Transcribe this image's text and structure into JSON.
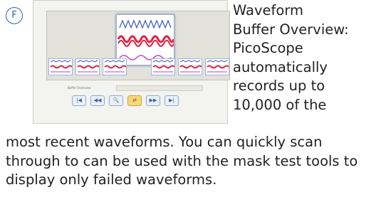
{
  "badge": {
    "letter": "F"
  },
  "screenshot": {
    "field_label": "Buffer Overview",
    "buttons": [
      {
        "glyph": "|◀",
        "icon": "first-icon"
      },
      {
        "glyph": "◀◀",
        "icon": "previous-icon"
      },
      {
        "glyph": "🔍",
        "icon": "zoom-icon"
      },
      {
        "glyph": "⇄",
        "icon": "highlight-icon"
      },
      {
        "glyph": "▶▶",
        "icon": "next-icon"
      },
      {
        "glyph": "▶|",
        "icon": "last-icon"
      }
    ]
  },
  "text": {
    "side_lines": [
      "Waveform",
      "Buffer Overview:",
      "PicoScope",
      "automatically",
      "records up to",
      "10,000 of the"
    ],
    "bottom_lines": [
      "most recent waveforms.  You can quickly scan",
      "through to can be used with the mask test tools to",
      "display only failed waveforms."
    ]
  },
  "colors": {
    "accent": "#2e63a8",
    "wave_red": "#e02040",
    "wave_magenta": "#c040c0"
  }
}
